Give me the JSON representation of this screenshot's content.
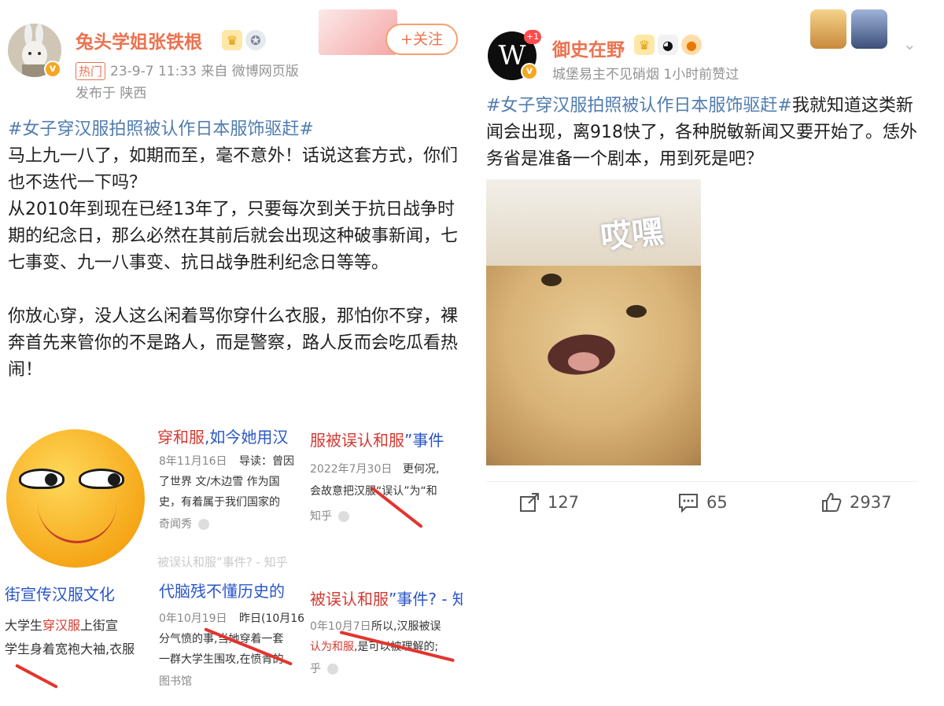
{
  "left_post": {
    "username": "兔头学姐张铁根",
    "hot_tag": "热门",
    "time_source": "23-9-7 11:33  来自 微博网页版",
    "location": "发布于 陕西",
    "follow_label": "+关注",
    "hashtag": "#女子穿汉服拍照被认作日本服饰驱赶#",
    "paragraphs": [
      "马上九一八了，如期而至，毫不意外！话说这套方式，你们也不迭代一下吗？",
      "从2010年到现在已经13年了，只要每次到关于抗日战争时期的纪念日，那么必然在其前后就会出现这种破事新闻，七七事变、九一八事变、抗日战争胜利纪念日等等。",
      "你放心穿，没人这么闲着骂你穿什么衣服，那怕你不穿，裸奔首先来管你的不是路人，而是警察，路人反而会吃瓜看热闹！"
    ],
    "collage": {
      "s1_title_red": "穿和服",
      "s1_title_blue": ",如今她用汉",
      "s1_date": "8年11月16日",
      "s1_l1": "导读：曾因",
      "s1_l2": "了世界 文/木边雪 作为国",
      "s1_l3": "史，有着属于我们国家的",
      "s1_src": "奇闻秀",
      "s2_title_red": "服被误认和服",
      "s2_title_blue": "”事件",
      "s2_date": "2022年7月30日",
      "s2_l1": "更何况,",
      "s2_l2": "会故意把汉服“误认”为“和",
      "s2_src": "知乎",
      "s3_title": "街宣传汉服文化",
      "s3_l1_a": "大学生",
      "s3_l1_red": "穿汉服",
      "s3_l1_b": "上街宣",
      "s3_l2": "学生身着宽袍大袖,衣服",
      "s4_title": "代脑残不懂历史的",
      "s4_date": "0年10月19日",
      "s4_l1": "昨日(10月16",
      "s4_l2": "分气愤的事,当她穿着一套",
      "s4_l3": "一群大学生围攻,在愤青的",
      "s4_src": "图书馆",
      "s5_title_red": "被误认和服",
      "s5_title_blue": "”事件? - 知",
      "s5_date": "0年10月7日",
      "s5_l1": "所以,汉服被误",
      "s5_l2_red": "认为和服",
      "s5_l2_b": ",是可以被理解的;",
      "s5_src": "乎",
      "faint_row": "被误认和服”事件? - 知乎"
    }
  },
  "right_post": {
    "username": "御史在野",
    "plus_badge": "+1",
    "meta": "城堡易主不见硝烟 1小时前赞过",
    "hashtag": "#女子穿汉服拍照被认作日本服饰驱赶#",
    "text": "我就知道这类新闻会出现，离918快了，各种脱敏新闻又要开始了。恁外务省是准备一个剧本，用到死是吧？",
    "meme_caption": "哎嘿",
    "actions": {
      "repost_count": "127",
      "comment_count": "65",
      "like_count": "2937"
    }
  },
  "colors": {
    "username": "#eb7350",
    "hashtag": "#507daf",
    "meta": "#939393"
  }
}
